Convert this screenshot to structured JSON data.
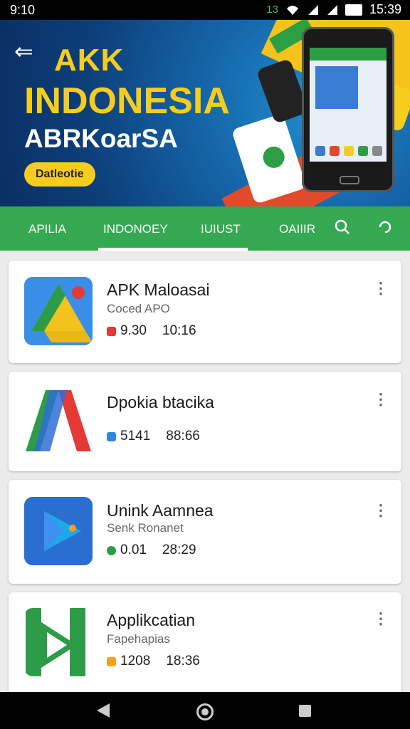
{
  "status_bar": {
    "time_left": "9:10",
    "indicator": "13",
    "time_right": "15:39"
  },
  "hero": {
    "line1": "AKK",
    "line2": "INDONESIA",
    "line3": "ABRKoarSA",
    "button_label": "Datleotie",
    "accent_color": "#f7cd1d"
  },
  "tabs": {
    "items": [
      {
        "label": "APILIA"
      },
      {
        "label": "INDONOEY"
      },
      {
        "label": "IUIUST"
      },
      {
        "label": "OAIIIR"
      }
    ],
    "active_index": 1,
    "color": "#35a952"
  },
  "apps": [
    {
      "title": "APK Maloasai",
      "subtitle": "Coced APO",
      "meta1": "9.30",
      "meta2": "10:16",
      "icon": "drive-icon"
    },
    {
      "title": "Dpokia btacika",
      "subtitle": "",
      "meta1": "5141",
      "meta2": "88:66",
      "icon": "a-logo-icon"
    },
    {
      "title": "Unink Aamnea",
      "subtitle": "Senk Ronanet",
      "meta1": "0.01",
      "meta2": "28:29",
      "icon": "play-icon"
    },
    {
      "title": "Applikcatian",
      "subtitle": "Fapehapias",
      "meta1": "1208",
      "meta2": "18:36",
      "icon": "n-logo-icon"
    }
  ]
}
